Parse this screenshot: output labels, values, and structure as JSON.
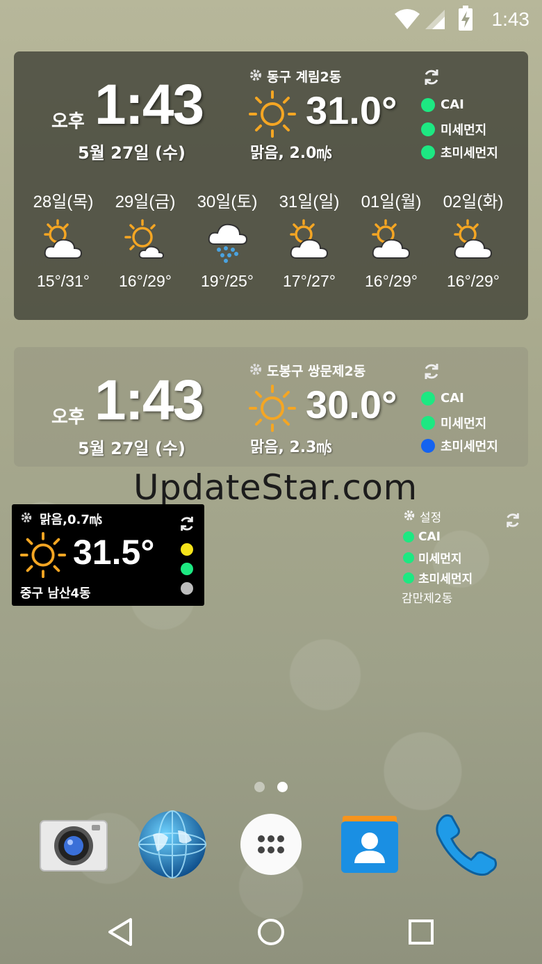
{
  "status_bar": {
    "time": "1:43"
  },
  "widget1": {
    "ampm": "오후",
    "time": "1:43",
    "date": "5월  27일 (수)",
    "location": "동구 계림2동",
    "temperature": "31.0°",
    "condition": "맑음, 2.0㎧",
    "aq": [
      {
        "label": "CAI",
        "color": "#1de882"
      },
      {
        "label": "미세먼지",
        "color": "#1de882"
      },
      {
        "label": "초미세먼지",
        "color": "#1de882"
      }
    ],
    "forecast": [
      {
        "day": "28일(목)",
        "icon": "partly-cloudy-icon",
        "temps": "15°/31°"
      },
      {
        "day": "29일(금)",
        "icon": "sun-small-cloud-icon",
        "temps": "16°/29°"
      },
      {
        "day": "30일(토)",
        "icon": "rain-cloud-icon",
        "temps": "19°/25°"
      },
      {
        "day": "31일(일)",
        "icon": "partly-cloudy-icon",
        "temps": "17°/27°"
      },
      {
        "day": "01일(월)",
        "icon": "partly-cloudy-icon",
        "temps": "16°/29°"
      },
      {
        "day": "02일(화)",
        "icon": "partly-cloudy-icon",
        "temps": "16°/29°"
      }
    ]
  },
  "widget2": {
    "ampm": "오후",
    "time": "1:43",
    "date": "5월  27일 (수)",
    "location": "도봉구 쌍문제2동",
    "temperature": "30.0°",
    "condition": "맑음, 2.3㎧",
    "aq": [
      {
        "label": "CAI",
        "color": "#1de882"
      },
      {
        "label": "미세먼지",
        "color": "#1de882"
      },
      {
        "label": "초미세먼지",
        "color": "#1463f0"
      }
    ]
  },
  "watermark": "UpdateStar.com",
  "widget3": {
    "condition": "맑음,0.7㎧",
    "temperature": "31.5°",
    "location": "중구 남산4동",
    "dots": [
      "#f5e31a",
      "#1de882",
      "#bdbdbd"
    ]
  },
  "widget4": {
    "settings": "설정",
    "aq": [
      {
        "label": "CAI",
        "color": "#1de882"
      },
      {
        "label": "미세먼지",
        "color": "#1de882"
      },
      {
        "label": "초미세먼지",
        "color": "#1de882"
      }
    ],
    "location": "감만제2동"
  },
  "dock": [
    "camera-icon",
    "browser-globe-icon",
    "app-drawer-icon",
    "contacts-icon",
    "phone-icon"
  ],
  "nav": [
    "back-icon",
    "home-icon",
    "recents-icon"
  ]
}
